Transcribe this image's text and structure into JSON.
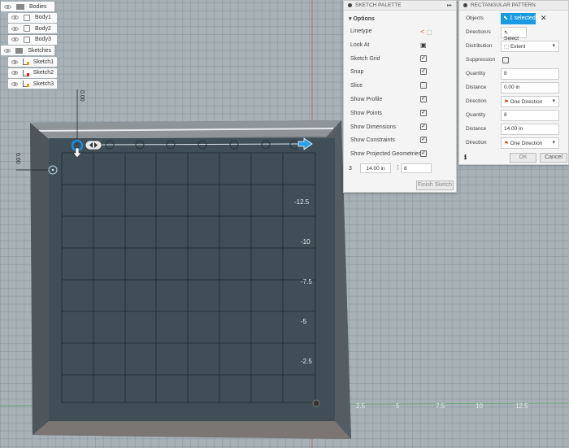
{
  "browser": {
    "items": [
      {
        "label": "Bodies",
        "type": "folder",
        "indent": 0
      },
      {
        "label": "Body1",
        "type": "body",
        "indent": 1
      },
      {
        "label": "Body2",
        "type": "body",
        "indent": 1
      },
      {
        "label": "Body3",
        "type": "body",
        "indent": 1
      },
      {
        "label": "Sketches",
        "type": "folder",
        "indent": 0
      },
      {
        "label": "Sketch1",
        "type": "sketch",
        "indent": 1
      },
      {
        "label": "Sketch2",
        "type": "sketch-error",
        "indent": 1
      },
      {
        "label": "Sketch3",
        "type": "sketch",
        "indent": 1
      }
    ]
  },
  "sketch_palette": {
    "title": "SKETCH PALETTE",
    "section": "Options",
    "options": [
      {
        "label": "Linetype",
        "control": "icons"
      },
      {
        "label": "Look At",
        "control": "icon"
      },
      {
        "label": "Sketch Grid",
        "checked": true
      },
      {
        "label": "Snap",
        "checked": true
      },
      {
        "label": "Slice",
        "checked": false
      },
      {
        "label": "Show Profile",
        "checked": true
      },
      {
        "label": "Show Points",
        "checked": true
      },
      {
        "label": "Show Dimensions",
        "checked": true
      },
      {
        "label": "Show Constraints",
        "checked": true
      },
      {
        "label": "Show Projected Geometries",
        "checked": true
      }
    ],
    "row_num": "3",
    "distance": "14.00 in",
    "quantity": "8",
    "finish": "Finish Sketch"
  },
  "pattern": {
    "title": "RECTANGULAR PATTERN",
    "objects_label": "Objects",
    "objects_value": "1 selected",
    "directions_label": "Direction/s",
    "directions_value": "Select",
    "distribution_label": "Distribution",
    "distribution_value": "Extent",
    "suppression_label": "Suppression",
    "quantity1_label": "Quantity",
    "quantity1": "8",
    "distance1_label": "Distance",
    "distance1": "0.00 in",
    "direction1_label": "Direction",
    "direction1": "One Direction",
    "quantity2_label": "Quantity",
    "quantity2": "8",
    "distance2_label": "Distance",
    "distance2": "14.00 in",
    "direction2_label": "Direction",
    "direction2": "One Direction",
    "ok": "OK",
    "cancel": "Cancel",
    "accent": "#1a9ae0"
  },
  "viewport": {
    "dim_top": "0.00",
    "dim_left": "0.00",
    "y_ticks": [
      "-12.5",
      "-10",
      "-7.5",
      "-5",
      "-2.5"
    ],
    "x_ticks": [
      "2.5",
      "5",
      "7.5",
      "10",
      "12.5"
    ]
  }
}
